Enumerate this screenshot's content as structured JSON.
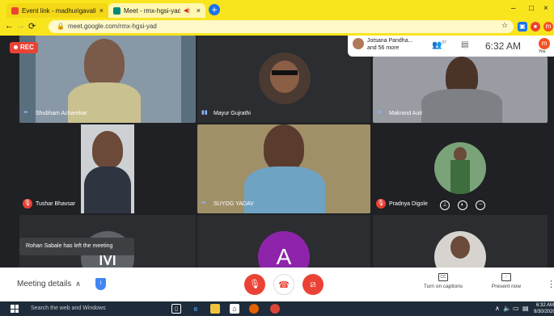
{
  "browser": {
    "tabs": [
      {
        "title": "Event link - madhurigavali@gm",
        "close": "×",
        "active": false
      },
      {
        "title": "Meet - rmx-hgsi-yad",
        "close": "×",
        "active": true
      }
    ],
    "new_tab": "+",
    "window_controls": {
      "minimize": "–",
      "maximize": "□",
      "close": "×"
    },
    "url": "meet.google.com/rmx-hgsi-yad",
    "profile_initial": "m"
  },
  "meet": {
    "recording_label": "REC",
    "presenter": {
      "name": "Jotsana Pandha...",
      "more": "and 56 more"
    },
    "participant_count": "67",
    "time": "6:32 AM",
    "self_label": "You",
    "self_initial": "m",
    "tiles": [
      {
        "name": "Shubham Acharekar",
        "status": "speaking-dots"
      },
      {
        "name": "Mayur Gujrathi",
        "status": "speaking"
      },
      {
        "name": "Makrand Auti",
        "status": "speaking-dots"
      },
      {
        "name": "Tushar Bhavsar",
        "status": "muted"
      },
      {
        "name": "SUYOG YADAV",
        "status": "speaking-dots"
      },
      {
        "name": "Pradnya Digole",
        "status": "muted"
      }
    ],
    "bottom_row": [
      {
        "letter": "M"
      },
      {
        "letter": "A"
      }
    ],
    "toast": "Rohan Sabale has left the meeting"
  },
  "bottom_bar": {
    "meeting_details": "Meeting details",
    "captions_label": "Turn on captions",
    "present_label": "Present now",
    "captions_icon": "CC"
  },
  "taskbar": {
    "search_placeholder": "Search the web and Windows",
    "clock_time": "6:32 AM",
    "clock_date": "9/30/2020"
  },
  "colors": {
    "chrome_theme": "#f9e51d",
    "meet_bg": "#202124",
    "danger": "#ea4335",
    "accent": "#1a73e8"
  }
}
